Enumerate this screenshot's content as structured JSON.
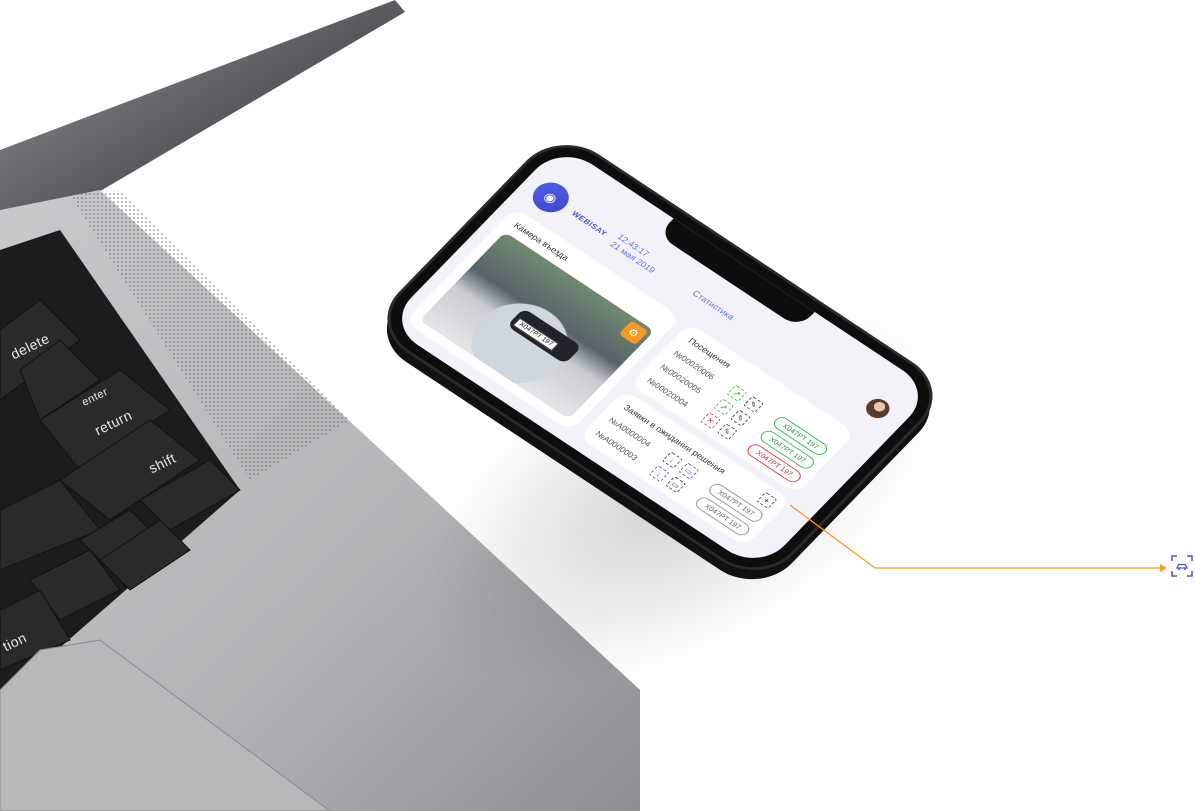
{
  "laptop": {
    "keys": {
      "delete": "delete",
      "enter": "enter",
      "return": "return",
      "shift": "shift",
      "option_partial": "tion"
    }
  },
  "app": {
    "brand": "WEBISAY",
    "time": "12:43:17",
    "date": "21 мая 2019",
    "stats_link": "Статистика",
    "camera": {
      "title": "Камера въезда",
      "plate_in_photo": "X047PT 197"
    },
    "visits": {
      "title": "Посещения",
      "rows": [
        {
          "id": "№00020006",
          "status": "green",
          "plate": "X047PT 197"
        },
        {
          "id": "№00020005",
          "status": "green",
          "plate": "X047PT 197"
        },
        {
          "id": "№00020004",
          "status": "red",
          "plate": "X047PT 197"
        }
      ]
    },
    "pending": {
      "title": "Заявки в ожидании решения",
      "rows": [
        {
          "id": "№A0000004",
          "plate": "X047PT 197"
        },
        {
          "id": "№A0000003",
          "plate": "X047PT 197"
        }
      ]
    }
  },
  "colors": {
    "accent_orange": "#f59a23",
    "brand_blue": "#4a56d8",
    "status_green": "#2ec24a",
    "status_red": "#e53945"
  }
}
